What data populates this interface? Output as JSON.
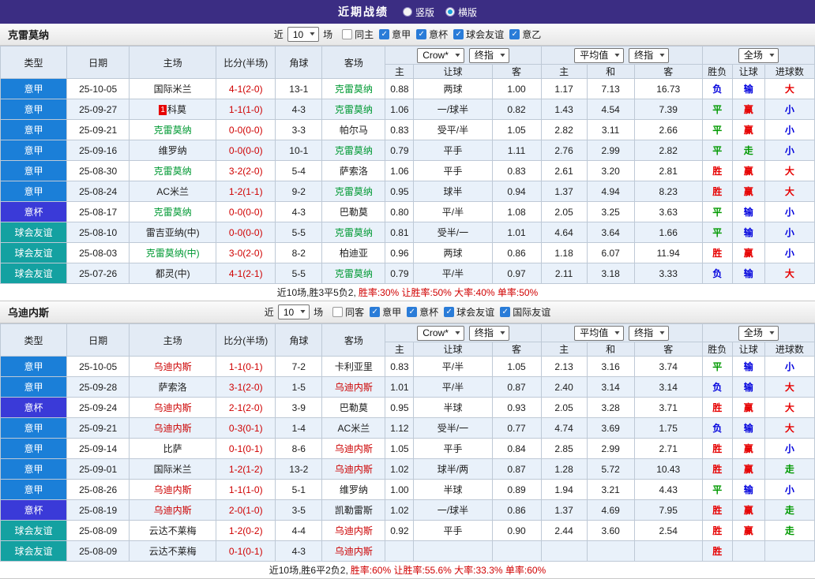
{
  "topbar": {
    "title": "近期战绩",
    "radios": [
      {
        "label": "竖版",
        "selected": false
      },
      {
        "label": "横版",
        "selected": true
      }
    ]
  },
  "colors": {
    "league": {
      "意甲": "#1b7fd8",
      "意杯": "#3a3ad8",
      "球会友谊": "#14a1a1"
    },
    "result": {
      "red": "#e60000",
      "green": "#009900",
      "blue": "#0000dd"
    },
    "self": [
      "#009933",
      "#cc0000"
    ]
  },
  "table_header": {
    "col_type": "类型",
    "col_date": "日期",
    "col_home": "主场",
    "col_score": "比分(半场)",
    "col_corner": "角球",
    "col_away": "客场",
    "dd_crow": "Crow*",
    "dd_final": "终指",
    "dd_avg": "平均值",
    "dd_full": "全场",
    "sub": [
      "主",
      "让球",
      "客",
      "主",
      "和",
      "客",
      "胜负",
      "让球",
      "进球数"
    ]
  },
  "sections": [
    {
      "team": "克雷莫纳",
      "filter": {
        "near": "近",
        "count": "10",
        "games": "场",
        "checkboxes": [
          {
            "label": "同主",
            "checked": false
          },
          {
            "label": "意甲",
            "checked": true
          },
          {
            "label": "意杯",
            "checked": true
          },
          {
            "label": "球会友谊",
            "checked": true
          },
          {
            "label": "意乙",
            "checked": true
          }
        ]
      },
      "rows": [
        {
          "league": "意甲",
          "date": "25-10-05",
          "home": "国际米兰",
          "home_self": false,
          "badge": "",
          "score": "4-1(2-0)",
          "corner": "13-1",
          "away": "克雷莫纳",
          "away_self": true,
          "odds": [
            "0.88",
            "两球",
            "1.00",
            "1.17",
            "7.13",
            "16.73"
          ],
          "results": [
            {
              "t": "负",
              "c": "blue"
            },
            {
              "t": "输",
              "c": "blue"
            },
            {
              "t": "大",
              "c": "red"
            }
          ]
        },
        {
          "league": "意甲",
          "date": "25-09-27",
          "home": "科莫",
          "home_self": false,
          "badge": "1",
          "score": "1-1(1-0)",
          "corner": "4-3",
          "away": "克雷莫纳",
          "away_self": true,
          "odds": [
            "1.06",
            "一/球半",
            "0.82",
            "1.43",
            "4.54",
            "7.39"
          ],
          "results": [
            {
              "t": "平",
              "c": "green"
            },
            {
              "t": "赢",
              "c": "red"
            },
            {
              "t": "小",
              "c": "blue"
            }
          ]
        },
        {
          "league": "意甲",
          "date": "25-09-21",
          "home": "克雷莫纳",
          "home_self": true,
          "badge": "",
          "score": "0-0(0-0)",
          "corner": "3-3",
          "away": "帕尔马",
          "away_self": false,
          "odds": [
            "0.83",
            "受平/半",
            "1.05",
            "2.82",
            "3.11",
            "2.66"
          ],
          "results": [
            {
              "t": "平",
              "c": "green"
            },
            {
              "t": "赢",
              "c": "red"
            },
            {
              "t": "小",
              "c": "blue"
            }
          ]
        },
        {
          "league": "意甲",
          "date": "25-09-16",
          "home": "维罗纳",
          "home_self": false,
          "badge": "",
          "score": "0-0(0-0)",
          "corner": "10-1",
          "away": "克雷莫纳",
          "away_self": true,
          "odds": [
            "0.79",
            "平手",
            "1.11",
            "2.76",
            "2.99",
            "2.82"
          ],
          "results": [
            {
              "t": "平",
              "c": "green"
            },
            {
              "t": "走",
              "c": "green"
            },
            {
              "t": "小",
              "c": "blue"
            }
          ]
        },
        {
          "league": "意甲",
          "date": "25-08-30",
          "home": "克雷莫纳",
          "home_self": true,
          "badge": "",
          "score": "3-2(2-0)",
          "corner": "5-4",
          "away": "萨索洛",
          "away_self": false,
          "odds": [
            "1.06",
            "平手",
            "0.83",
            "2.61",
            "3.20",
            "2.81"
          ],
          "results": [
            {
              "t": "胜",
              "c": "red"
            },
            {
              "t": "赢",
              "c": "red"
            },
            {
              "t": "大",
              "c": "red"
            }
          ]
        },
        {
          "league": "意甲",
          "date": "25-08-24",
          "home": "AC米兰",
          "home_self": false,
          "badge": "",
          "score": "1-2(1-1)",
          "corner": "9-2",
          "away": "克雷莫纳",
          "away_self": true,
          "odds": [
            "0.95",
            "球半",
            "0.94",
            "1.37",
            "4.94",
            "8.23"
          ],
          "results": [
            {
              "t": "胜",
              "c": "red"
            },
            {
              "t": "赢",
              "c": "red"
            },
            {
              "t": "大",
              "c": "red"
            }
          ]
        },
        {
          "league": "意杯",
          "date": "25-08-17",
          "home": "克雷莫纳",
          "home_self": true,
          "badge": "",
          "score": "0-0(0-0)",
          "corner": "4-3",
          "away": "巴勒莫",
          "away_self": false,
          "odds": [
            "0.80",
            "平/半",
            "1.08",
            "2.05",
            "3.25",
            "3.63"
          ],
          "results": [
            {
              "t": "平",
              "c": "green"
            },
            {
              "t": "输",
              "c": "blue"
            },
            {
              "t": "小",
              "c": "blue"
            }
          ]
        },
        {
          "league": "球会友谊",
          "date": "25-08-10",
          "home": "雷吉亚纳(中)",
          "home_self": false,
          "badge": "",
          "score": "0-0(0-0)",
          "corner": "5-5",
          "away": "克雷莫纳",
          "away_self": true,
          "odds": [
            "0.81",
            "受半/一",
            "1.01",
            "4.64",
            "3.64",
            "1.66"
          ],
          "results": [
            {
              "t": "平",
              "c": "green"
            },
            {
              "t": "输",
              "c": "blue"
            },
            {
              "t": "小",
              "c": "blue"
            }
          ]
        },
        {
          "league": "球会友谊",
          "date": "25-08-03",
          "home": "克雷莫纳(中)",
          "home_self": true,
          "badge": "",
          "score": "3-0(2-0)",
          "corner": "8-2",
          "away": "柏迪亚",
          "away_self": false,
          "odds": [
            "0.96",
            "两球",
            "0.86",
            "1.18",
            "6.07",
            "11.94"
          ],
          "results": [
            {
              "t": "胜",
              "c": "red"
            },
            {
              "t": "赢",
              "c": "red"
            },
            {
              "t": "小",
              "c": "blue"
            }
          ]
        },
        {
          "league": "球会友谊",
          "date": "25-07-26",
          "home": "都灵(中)",
          "home_self": false,
          "badge": "",
          "score": "4-1(2-1)",
          "corner": "5-5",
          "away": "克雷莫纳",
          "away_self": true,
          "odds": [
            "0.79",
            "平/半",
            "0.97",
            "2.11",
            "3.18",
            "3.33"
          ],
          "results": [
            {
              "t": "负",
              "c": "blue"
            },
            {
              "t": "输",
              "c": "blue"
            },
            {
              "t": "大",
              "c": "red"
            }
          ]
        }
      ],
      "summary": {
        "prefix": "近10场,胜3平5负2, ",
        "rates": "胜率:30% 让胜率:50% 大率:40% 单率:50%"
      }
    },
    {
      "team": "乌迪内斯",
      "filter": {
        "near": "近",
        "count": "10",
        "games": "场",
        "checkboxes": [
          {
            "label": "同客",
            "checked": false
          },
          {
            "label": "意甲",
            "checked": true
          },
          {
            "label": "意杯",
            "checked": true
          },
          {
            "label": "球会友谊",
            "checked": true
          },
          {
            "label": "国际友谊",
            "checked": true
          }
        ]
      },
      "rows": [
        {
          "league": "意甲",
          "date": "25-10-05",
          "home": "乌迪内斯",
          "home_self": true,
          "badge": "",
          "score": "1-1(0-1)",
          "corner": "7-2",
          "away": "卡利亚里",
          "away_self": false,
          "odds": [
            "0.83",
            "平/半",
            "1.05",
            "2.13",
            "3.16",
            "3.74"
          ],
          "results": [
            {
              "t": "平",
              "c": "green"
            },
            {
              "t": "输",
              "c": "blue"
            },
            {
              "t": "小",
              "c": "blue"
            }
          ]
        },
        {
          "league": "意甲",
          "date": "25-09-28",
          "home": "萨索洛",
          "home_self": false,
          "badge": "",
          "score": "3-1(2-0)",
          "corner": "1-5",
          "away": "乌迪内斯",
          "away_self": true,
          "odds": [
            "1.01",
            "平/半",
            "0.87",
            "2.40",
            "3.14",
            "3.14"
          ],
          "results": [
            {
              "t": "负",
              "c": "blue"
            },
            {
              "t": "输",
              "c": "blue"
            },
            {
              "t": "大",
              "c": "red"
            }
          ]
        },
        {
          "league": "意杯",
          "date": "25-09-24",
          "home": "乌迪内斯",
          "home_self": true,
          "badge": "",
          "score": "2-1(2-0)",
          "corner": "3-9",
          "away": "巴勒莫",
          "away_self": false,
          "odds": [
            "0.95",
            "半球",
            "0.93",
            "2.05",
            "3.28",
            "3.71"
          ],
          "results": [
            {
              "t": "胜",
              "c": "red"
            },
            {
              "t": "赢",
              "c": "red"
            },
            {
              "t": "大",
              "c": "red"
            }
          ]
        },
        {
          "league": "意甲",
          "date": "25-09-21",
          "home": "乌迪内斯",
          "home_self": true,
          "badge": "",
          "score": "0-3(0-1)",
          "corner": "1-4",
          "away": "AC米兰",
          "away_self": false,
          "odds": [
            "1.12",
            "受半/一",
            "0.77",
            "4.74",
            "3.69",
            "1.75"
          ],
          "results": [
            {
              "t": "负",
              "c": "blue"
            },
            {
              "t": "输",
              "c": "blue"
            },
            {
              "t": "大",
              "c": "red"
            }
          ]
        },
        {
          "league": "意甲",
          "date": "25-09-14",
          "home": "比萨",
          "home_self": false,
          "badge": "",
          "score": "0-1(0-1)",
          "corner": "8-6",
          "away": "乌迪内斯",
          "away_self": true,
          "odds": [
            "1.05",
            "平手",
            "0.84",
            "2.85",
            "2.99",
            "2.71"
          ],
          "results": [
            {
              "t": "胜",
              "c": "red"
            },
            {
              "t": "赢",
              "c": "red"
            },
            {
              "t": "小",
              "c": "blue"
            }
          ]
        },
        {
          "league": "意甲",
          "date": "25-09-01",
          "home": "国际米兰",
          "home_self": false,
          "badge": "",
          "score": "1-2(1-2)",
          "corner": "13-2",
          "away": "乌迪内斯",
          "away_self": true,
          "odds": [
            "1.02",
            "球半/两",
            "0.87",
            "1.28",
            "5.72",
            "10.43"
          ],
          "results": [
            {
              "t": "胜",
              "c": "red"
            },
            {
              "t": "赢",
              "c": "red"
            },
            {
              "t": "走",
              "c": "green"
            }
          ]
        },
        {
          "league": "意甲",
          "date": "25-08-26",
          "home": "乌迪内斯",
          "home_self": true,
          "badge": "",
          "score": "1-1(1-0)",
          "corner": "5-1",
          "away": "维罗纳",
          "away_self": false,
          "odds": [
            "1.00",
            "半球",
            "0.89",
            "1.94",
            "3.21",
            "4.43"
          ],
          "results": [
            {
              "t": "平",
              "c": "green"
            },
            {
              "t": "输",
              "c": "blue"
            },
            {
              "t": "小",
              "c": "blue"
            }
          ]
        },
        {
          "league": "意杯",
          "date": "25-08-19",
          "home": "乌迪内斯",
          "home_self": true,
          "badge": "",
          "score": "2-0(1-0)",
          "corner": "3-5",
          "away": "凯勒雷斯",
          "away_self": false,
          "odds": [
            "1.02",
            "一/球半",
            "0.86",
            "1.37",
            "4.69",
            "7.95"
          ],
          "results": [
            {
              "t": "胜",
              "c": "red"
            },
            {
              "t": "赢",
              "c": "red"
            },
            {
              "t": "走",
              "c": "green"
            }
          ]
        },
        {
          "league": "球会友谊",
          "date": "25-08-09",
          "home": "云达不莱梅",
          "home_self": false,
          "badge": "",
          "score": "1-2(0-2)",
          "corner": "4-4",
          "away": "乌迪内斯",
          "away_self": true,
          "odds": [
            "0.92",
            "平手",
            "0.90",
            "2.44",
            "3.60",
            "2.54"
          ],
          "results": [
            {
              "t": "胜",
              "c": "red"
            },
            {
              "t": "赢",
              "c": "red"
            },
            {
              "t": "走",
              "c": "green"
            }
          ]
        },
        {
          "league": "球会友谊",
          "date": "25-08-09",
          "home": "云达不莱梅",
          "home_self": false,
          "badge": "",
          "score": "0-1(0-1)",
          "corner": "4-3",
          "away": "乌迪内斯",
          "away_self": true,
          "odds": [
            "",
            "",
            "",
            "",
            "",
            ""
          ],
          "results": [
            {
              "t": "胜",
              "c": "red"
            },
            {
              "t": "",
              "c": ""
            },
            {
              "t": "",
              "c": ""
            }
          ]
        }
      ],
      "summary": {
        "prefix": "近10场,胜6平2负2, ",
        "rates": "胜率:60% 让胜率:55.6% 大率:33.3% 单率:60%"
      }
    }
  ]
}
